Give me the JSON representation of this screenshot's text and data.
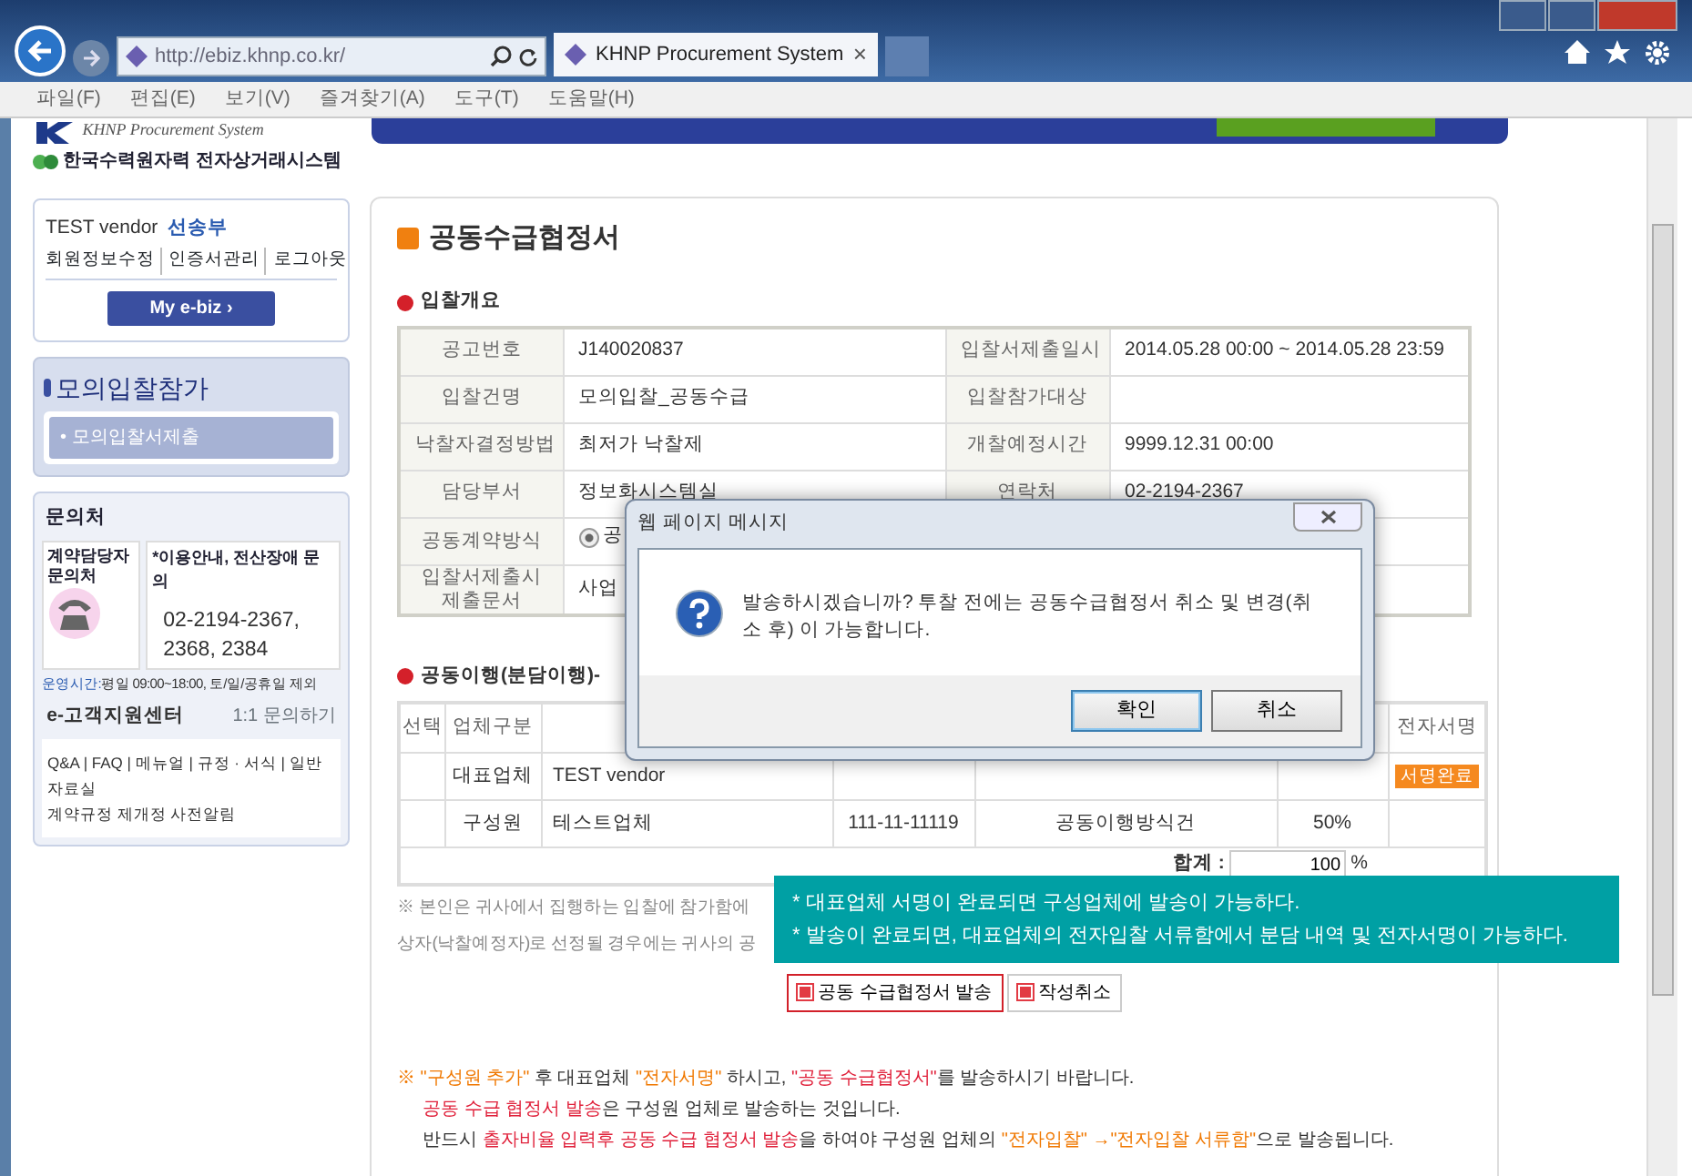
{
  "browser": {
    "address": "http://ebiz.khnp.co.kr/",
    "tab": {
      "title": "KHNP Procurement System",
      "close": "×"
    },
    "menu": [
      "파일(F)",
      "편집(E)",
      "보기(V)",
      "즐겨찾기(A)",
      "도구(T)",
      "도움말(H)"
    ]
  },
  "logo": {
    "subtitle": "KHNP Procurement System",
    "name": "한국수력원자력 전자상거래시스템"
  },
  "user": {
    "company": "TEST vendor",
    "person": "선송부",
    "links": [
      "회원정보수정",
      "인증서관리",
      "로그아웃"
    ],
    "button": "My e-biz ›"
  },
  "sidebar": {
    "title": "모의입찰참가",
    "items": [
      {
        "label": "• 모의입찰서제출",
        "selected": true
      }
    ]
  },
  "contact": {
    "title": "문의처",
    "card_title": "계약담당자 문의처",
    "info_title": "*이용안내, 전산장애 문의",
    "phone": "02-2194-2367, 2368, 2384",
    "hours_label": "운영시간:",
    "hours": "평일 09:00~18:00, 토/일/공휴일 제외",
    "center_title": "e-고객지원센터",
    "center_link": "1:1 문의하기",
    "center_links": "Q&A | FAQ | 메뉴얼 | 규정 · 서식 | 일반자료실",
    "center_notice": "계약규정 제개정 사전알림"
  },
  "page_title": "공동수급협정서",
  "overview": {
    "title": "입찰개요",
    "rows": [
      {
        "cells": [
          {
            "label": "공고번호",
            "value": "J140020837"
          },
          {
            "label": "입찰서제출일시",
            "value": "2014.05.28 00:00 ~ 2014.05.28 23:59"
          }
        ]
      },
      {
        "cells": [
          {
            "label": "입찰건명",
            "value": "모의입찰_공동수급"
          },
          {
            "label": "입찰참가대상"
          }
        ]
      },
      {
        "cells": [
          {
            "label": "낙찰자결정방법",
            "value": "최저가 낙찰제"
          },
          {
            "label": "개찰예정시간",
            "value": "9999.12.31 00:00"
          }
        ]
      },
      {
        "cells": [
          {
            "label": "담당부서",
            "value": "정보화시스템실"
          },
          {
            "label": "연락처",
            "value": "02-2194-2367"
          }
        ]
      },
      {
        "cells": [
          {
            "label": "공동계약방식",
            "value": "공",
            "kind": "radio",
            "checked": true
          }
        ]
      },
      {
        "cells": [
          {
            "label": "입찰서제출시 제출문서",
            "value": "사업"
          }
        ]
      }
    ]
  },
  "members": {
    "title": "공동이행(분담이행)-",
    "columns": [
      "선택",
      "업체구분",
      "전자서명"
    ],
    "rows": [
      {
        "role": "대표업체",
        "company": "TEST vendor",
        "signature": "서명완료"
      },
      {
        "role": "구성원",
        "company": "테스트업체",
        "reg_no": "111-11-11119",
        "method": "공동이행방식건",
        "share": "50%"
      }
    ],
    "total_label": "합계 :",
    "total_value": "100",
    "total_unit": "%"
  },
  "notice": [
    "※ 본인은 귀사에서 집행하는 입찰에 참가함에",
    "상자(낙찰예정자)로 선정될 경우에는 귀사의 공"
  ],
  "actions": [
    {
      "label": "공동 수급협정서 발송",
      "selected": true
    },
    {
      "label": "작성취소",
      "selected": false
    }
  ],
  "notes": [
    [
      {
        "text": "※ ",
        "kind": "orange"
      },
      {
        "text": "\"구성원 추가\"",
        "kind": "orange"
      },
      {
        "text": " 후 대표업체 ",
        "kind": "plain"
      },
      {
        "text": "\"전자서명\"",
        "kind": "orange"
      },
      {
        "text": " 하시고, ",
        "kind": "plain"
      },
      {
        "text": "\"공동 수급협정서\"",
        "kind": "red"
      },
      {
        "text": "를 발송하시기 바랍니다.",
        "kind": "plain"
      }
    ],
    [
      {
        "text": "공동 수급 협정서 발송",
        "kind": "red"
      },
      {
        "text": "은 구성원 업체로 발송하는 것입니다.",
        "kind": "plain"
      }
    ],
    [
      {
        "text": "반드시 ",
        "kind": "plain"
      },
      {
        "text": "출자비율 입력후 공동 수급 협정서 발송",
        "kind": "red"
      },
      {
        "text": "을 하여야 구성원 업체의 ",
        "kind": "plain"
      },
      {
        "text": "\"전자입찰\" →\"전자입찰 서류함\"",
        "kind": "orange"
      },
      {
        "text": "으로 발송됩니다.",
        "kind": "plain"
      }
    ]
  ],
  "tooltip": [
    "* 대표업체 서명이 완료되면 구성업체에 발송이 가능하다.",
    "* 발송이 완료되면, 대표업체의 전자입찰 서류함에서 분담 내역 및 전자서명이 가능하다."
  ],
  "dialog": {
    "title": "웹 페이지 메시지",
    "message": "발송하시겠습니까? 투찰 전에는 공동수급협정서 취소 및 변경(취소 후) 이 가능합니다.",
    "buttons": [
      {
        "label": "확인",
        "selected": true
      },
      {
        "label": "취소",
        "selected": false
      }
    ]
  }
}
